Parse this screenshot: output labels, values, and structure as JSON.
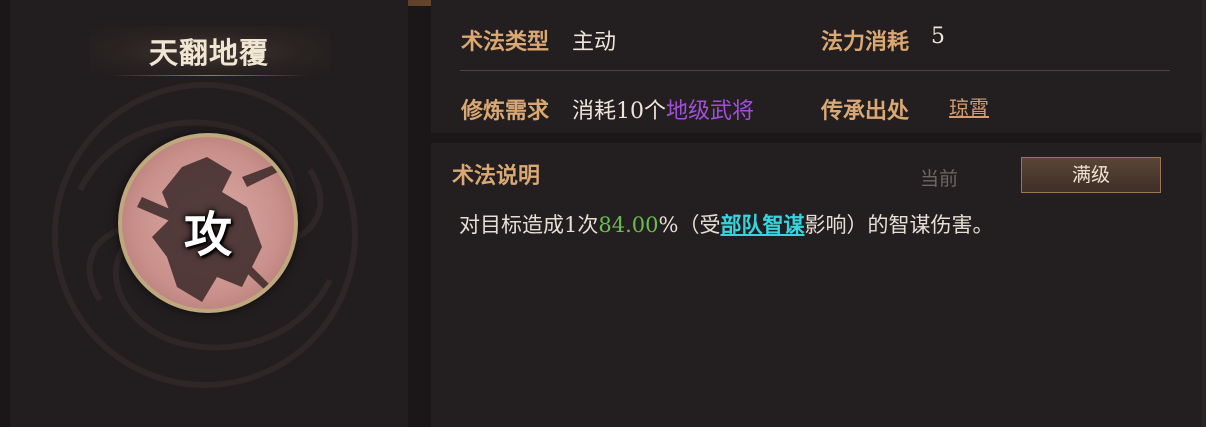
{
  "skill": {
    "name": "天翻地覆",
    "type_char": "攻"
  },
  "info": {
    "type_label": "术法类型",
    "type_value": "主动",
    "cost_label": "法力消耗",
    "cost_value": "5",
    "req_label": "修炼需求",
    "req_prefix": "消耗10个",
    "req_highlight": "地级武将",
    "origin_label": "传承出处",
    "origin_value": "琼霄"
  },
  "description": {
    "label": "术法说明",
    "tab_current": "当前",
    "tab_max": "满级",
    "text_prefix": "对目标造成1次",
    "percent_number": "84.00",
    "text_mid1": "%（受",
    "link_text": "部队智谋",
    "text_suffix": "影响）的智谋伤害。"
  },
  "colors": {
    "label": "#d9a873",
    "purple": "#a24fd8",
    "green": "#6bbd4f",
    "cyan": "#35d5e0",
    "accent_orange": "#d79c6e"
  }
}
